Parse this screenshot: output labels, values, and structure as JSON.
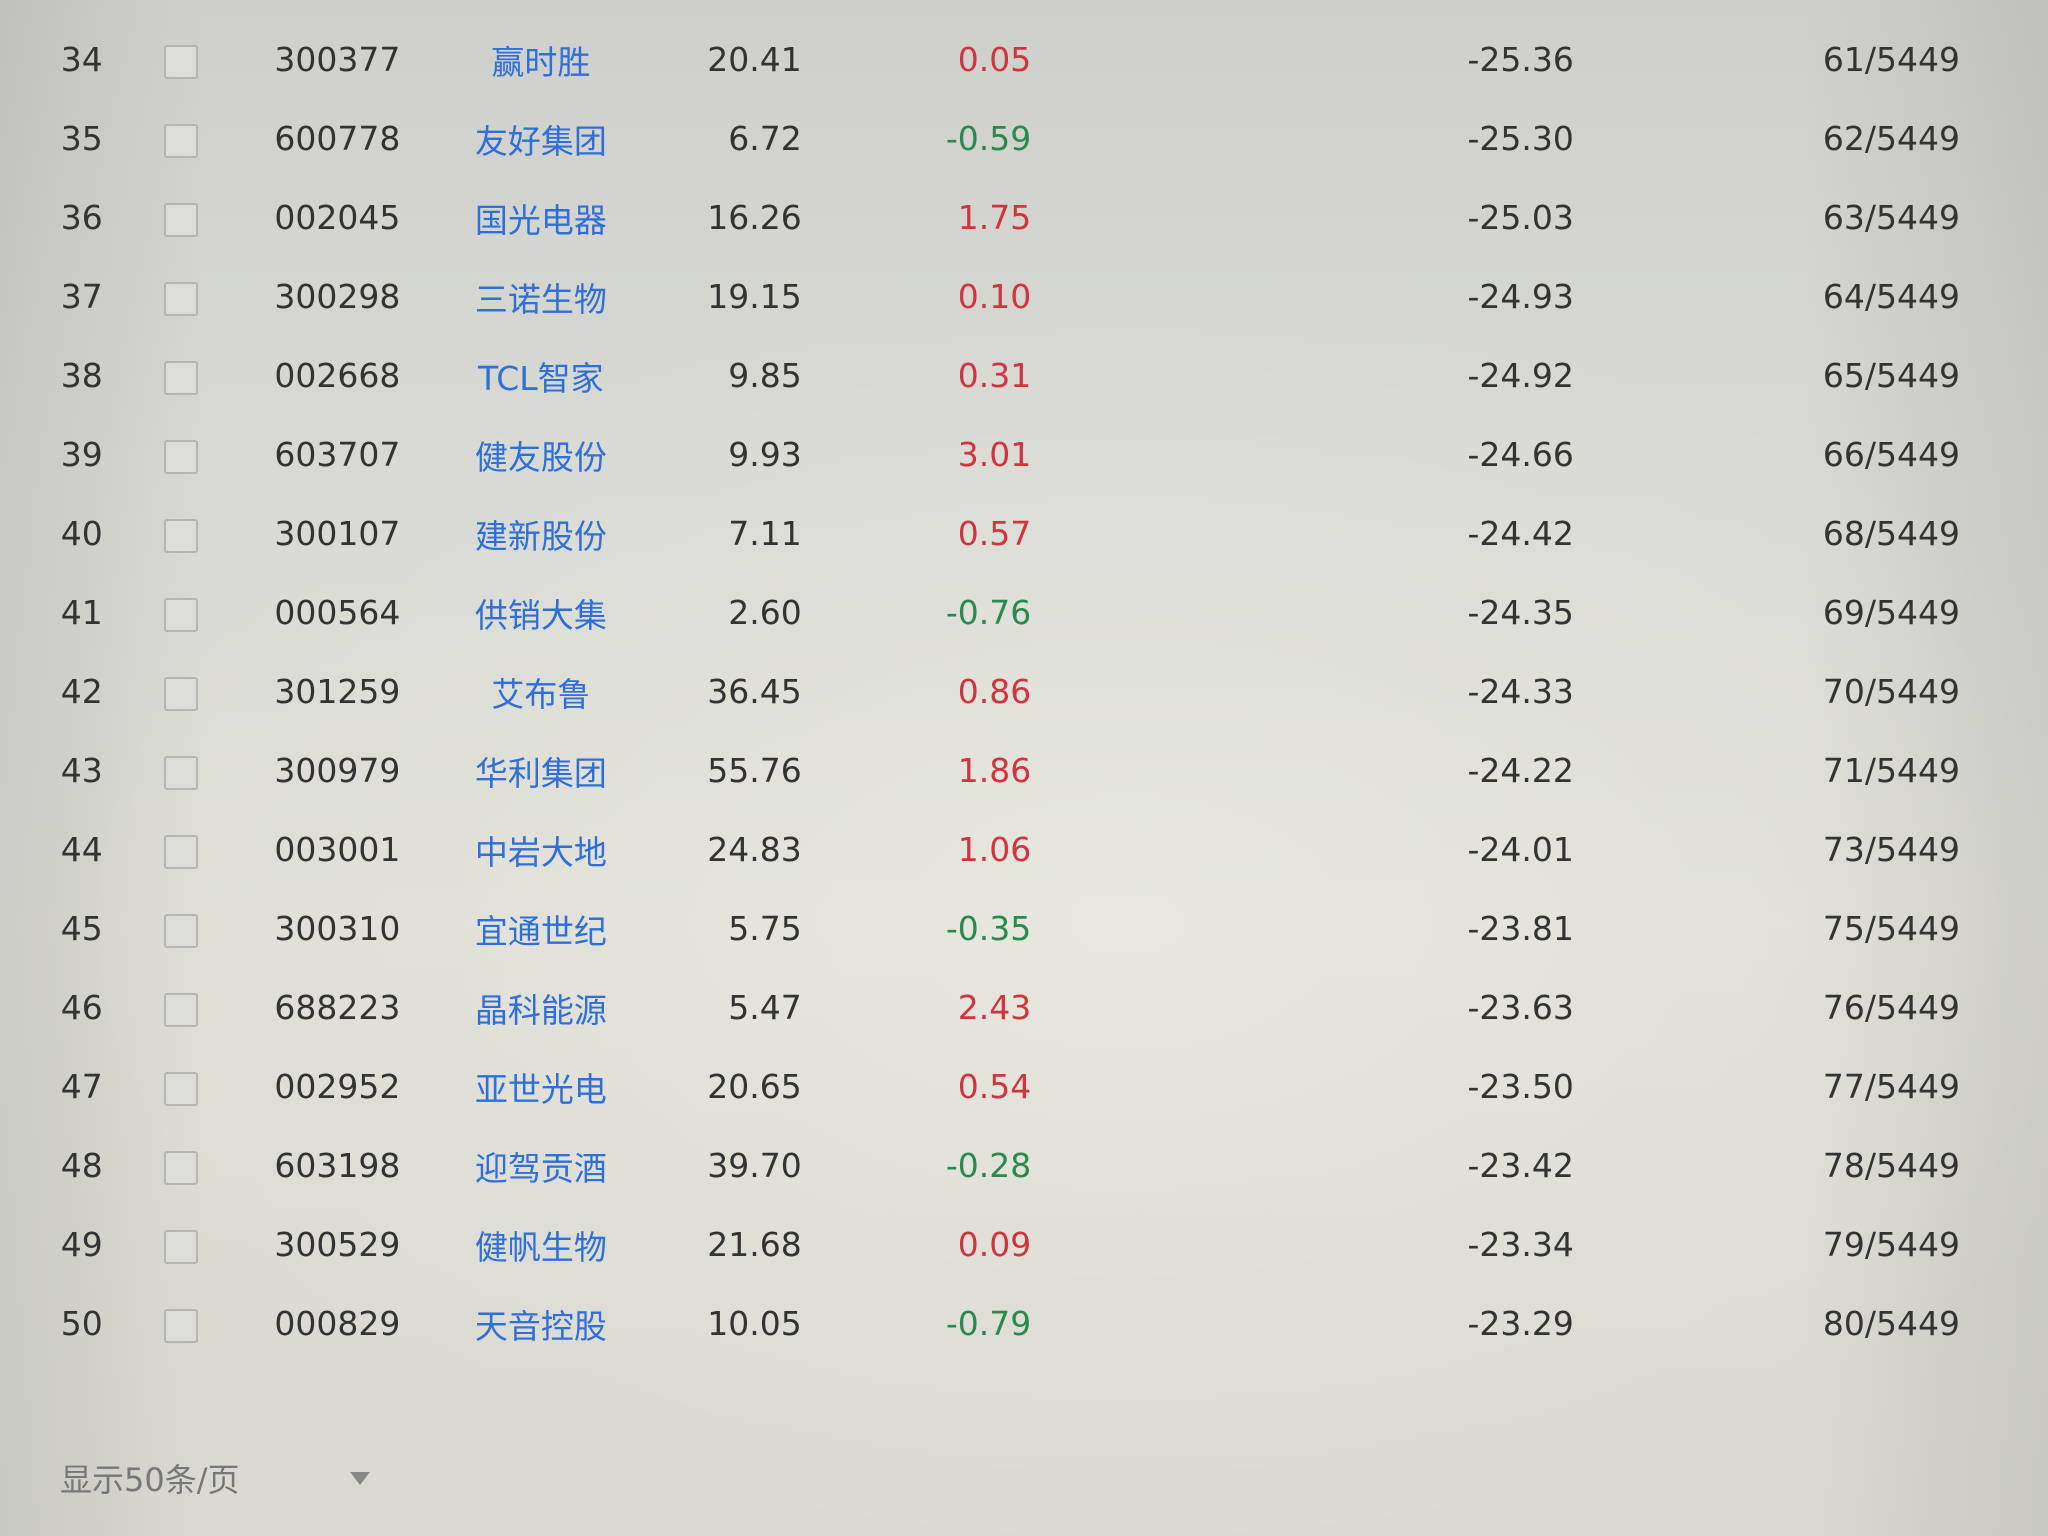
{
  "colors": {
    "up": "#d0343f",
    "down": "#2a8a4e",
    "name_link": "#2f6fd8",
    "text": "#333333"
  },
  "rows": [
    {
      "idx": "34",
      "code": "300377",
      "name": "赢时胜",
      "price": "20.41",
      "change": "0.05",
      "direction": "up",
      "value": "-25.36",
      "rank": "61/5449"
    },
    {
      "idx": "35",
      "code": "600778",
      "name": "友好集团",
      "price": "6.72",
      "change": "-0.59",
      "direction": "down",
      "value": "-25.30",
      "rank": "62/5449"
    },
    {
      "idx": "36",
      "code": "002045",
      "name": "国光电器",
      "price": "16.26",
      "change": "1.75",
      "direction": "up",
      "value": "-25.03",
      "rank": "63/5449"
    },
    {
      "idx": "37",
      "code": "300298",
      "name": "三诺生物",
      "price": "19.15",
      "change": "0.10",
      "direction": "up",
      "value": "-24.93",
      "rank": "64/5449"
    },
    {
      "idx": "38",
      "code": "002668",
      "name": "TCL智家",
      "price": "9.85",
      "change": "0.31",
      "direction": "up",
      "value": "-24.92",
      "rank": "65/5449"
    },
    {
      "idx": "39",
      "code": "603707",
      "name": "健友股份",
      "price": "9.93",
      "change": "3.01",
      "direction": "up",
      "value": "-24.66",
      "rank": "66/5449"
    },
    {
      "idx": "40",
      "code": "300107",
      "name": "建新股份",
      "price": "7.11",
      "change": "0.57",
      "direction": "up",
      "value": "-24.42",
      "rank": "68/5449"
    },
    {
      "idx": "41",
      "code": "000564",
      "name": "供销大集",
      "price": "2.60",
      "change": "-0.76",
      "direction": "down",
      "value": "-24.35",
      "rank": "69/5449"
    },
    {
      "idx": "42",
      "code": "301259",
      "name": "艾布鲁",
      "price": "36.45",
      "change": "0.86",
      "direction": "up",
      "value": "-24.33",
      "rank": "70/5449"
    },
    {
      "idx": "43",
      "code": "300979",
      "name": "华利集团",
      "price": "55.76",
      "change": "1.86",
      "direction": "up",
      "value": "-24.22",
      "rank": "71/5449"
    },
    {
      "idx": "44",
      "code": "003001",
      "name": "中岩大地",
      "price": "24.83",
      "change": "1.06",
      "direction": "up",
      "value": "-24.01",
      "rank": "73/5449"
    },
    {
      "idx": "45",
      "code": "300310",
      "name": "宜通世纪",
      "price": "5.75",
      "change": "-0.35",
      "direction": "down",
      "value": "-23.81",
      "rank": "75/5449"
    },
    {
      "idx": "46",
      "code": "688223",
      "name": "晶科能源",
      "price": "5.47",
      "change": "2.43",
      "direction": "up",
      "value": "-23.63",
      "rank": "76/5449"
    },
    {
      "idx": "47",
      "code": "002952",
      "name": "亚世光电",
      "price": "20.65",
      "change": "0.54",
      "direction": "up",
      "value": "-23.50",
      "rank": "77/5449"
    },
    {
      "idx": "48",
      "code": "603198",
      "name": "迎驾贡酒",
      "price": "39.70",
      "change": "-0.28",
      "direction": "down",
      "value": "-23.42",
      "rank": "78/5449"
    },
    {
      "idx": "49",
      "code": "300529",
      "name": "健帆生物",
      "price": "21.68",
      "change": "0.09",
      "direction": "up",
      "value": "-23.34",
      "rank": "79/5449"
    },
    {
      "idx": "50",
      "code": "000829",
      "name": "天音控股",
      "price": "10.05",
      "change": "-0.79",
      "direction": "down",
      "value": "-23.29",
      "rank": "80/5449"
    }
  ],
  "pager": {
    "label": "显示50条/页",
    "dropdown_icon": "caret-down-icon"
  }
}
